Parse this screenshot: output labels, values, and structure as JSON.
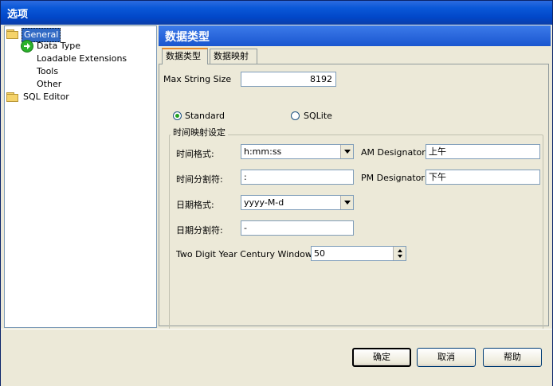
{
  "window": {
    "title": "选项"
  },
  "tree": {
    "items": [
      {
        "label": "General"
      },
      {
        "label": "Data Type"
      },
      {
        "label": "Loadable Extensions"
      },
      {
        "label": "Tools"
      },
      {
        "label": "Other"
      },
      {
        "label": "SQL Editor"
      }
    ]
  },
  "header": {
    "title": "数据类型"
  },
  "tabs": [
    {
      "label": "数据类型"
    },
    {
      "label": "数据映射"
    }
  ],
  "form": {
    "max_string_size_label": "Max String Size",
    "max_string_size_value": "8192",
    "group_title": "时间映射设定",
    "radio_standard": "Standard",
    "radio_sqlite": "SQLite",
    "time_format_label": "时间格式:",
    "time_format_value": "h:mm:ss",
    "time_sep_label": "时间分割符:",
    "time_sep_value": ":",
    "date_format_label": "日期格式:",
    "date_format_value": "yyyy-M-d",
    "date_sep_label": "日期分割符:",
    "date_sep_value": "-",
    "am_label": "AM Designator:",
    "am_value": "上午",
    "pm_label": "PM Designator:",
    "pm_value": "下午",
    "century_label": "Two Digit Year Century Window",
    "century_value": "50"
  },
  "buttons": {
    "ok": "确定",
    "cancel": "取消",
    "help": "帮助"
  },
  "colors": {
    "titlebar": "#0147c8",
    "selection": "#316ac5",
    "header": "#1f5ed8"
  }
}
